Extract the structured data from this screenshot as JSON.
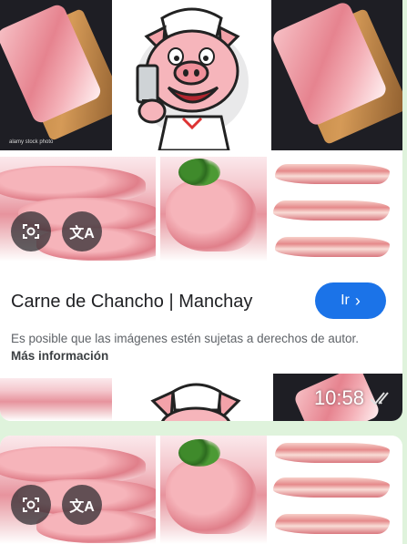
{
  "result": {
    "title": "Carne de Chancho | Manchay",
    "go_label": "Ir",
    "notice_text": "Es posible que las imágenes estén sujetas a derechos de autor.",
    "notice_link": "Más información"
  },
  "message": {
    "time": "10:58",
    "status_icon": "double-check-read-icon"
  },
  "overlay_buttons": {
    "lens_icon": "google-lens-icon",
    "translate_icon": "translate-icon"
  },
  "watermark": "alamy stock photo",
  "colors": {
    "button_blue": "#1b73e8",
    "chat_bg": "#dff3dc",
    "bubble_bg": "#ffffff"
  }
}
